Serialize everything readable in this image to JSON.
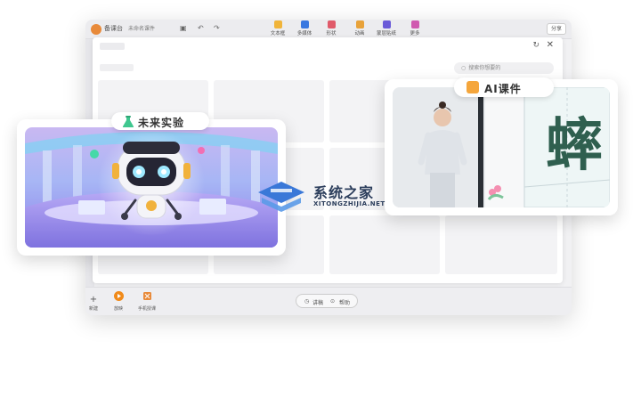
{
  "app": {
    "name": "备课台",
    "doc_tab": "未命名课件",
    "share_label": "分享",
    "toolbar": [
      {
        "label": "文本框",
        "color": "#f0b43a"
      },
      {
        "label": "多媒体",
        "color": "#3a78e0"
      },
      {
        "label": "形状",
        "color": "#e05a6a"
      },
      {
        "label": "动画",
        "color": "#e8a23a"
      },
      {
        "label": "蒙层贴纸",
        "color": "#6a5ad8"
      },
      {
        "label": "更多",
        "color": "#d05ab0"
      }
    ],
    "bottom": [
      {
        "label": "新建",
        "icon": "plus-icon"
      },
      {
        "label": "放映",
        "icon": "play-icon"
      },
      {
        "label": "手机授课",
        "icon": "phone-icon"
      }
    ],
    "pill": {
      "left": "讲稿",
      "right": "帮助"
    }
  },
  "dialog": {
    "search_placeholder": "搜索你想要的"
  },
  "cards": {
    "lab_title": "未来实验",
    "ai_title": "AI课件",
    "hanzi": "蟀"
  },
  "watermark": {
    "main": "系统之家",
    "url": "XITONGZHIJIA.NET"
  },
  "colors": {
    "accent_orange": "#f5a63c",
    "lab_bg": "#a7b6f5",
    "hanzi": "#2f5f4f"
  }
}
